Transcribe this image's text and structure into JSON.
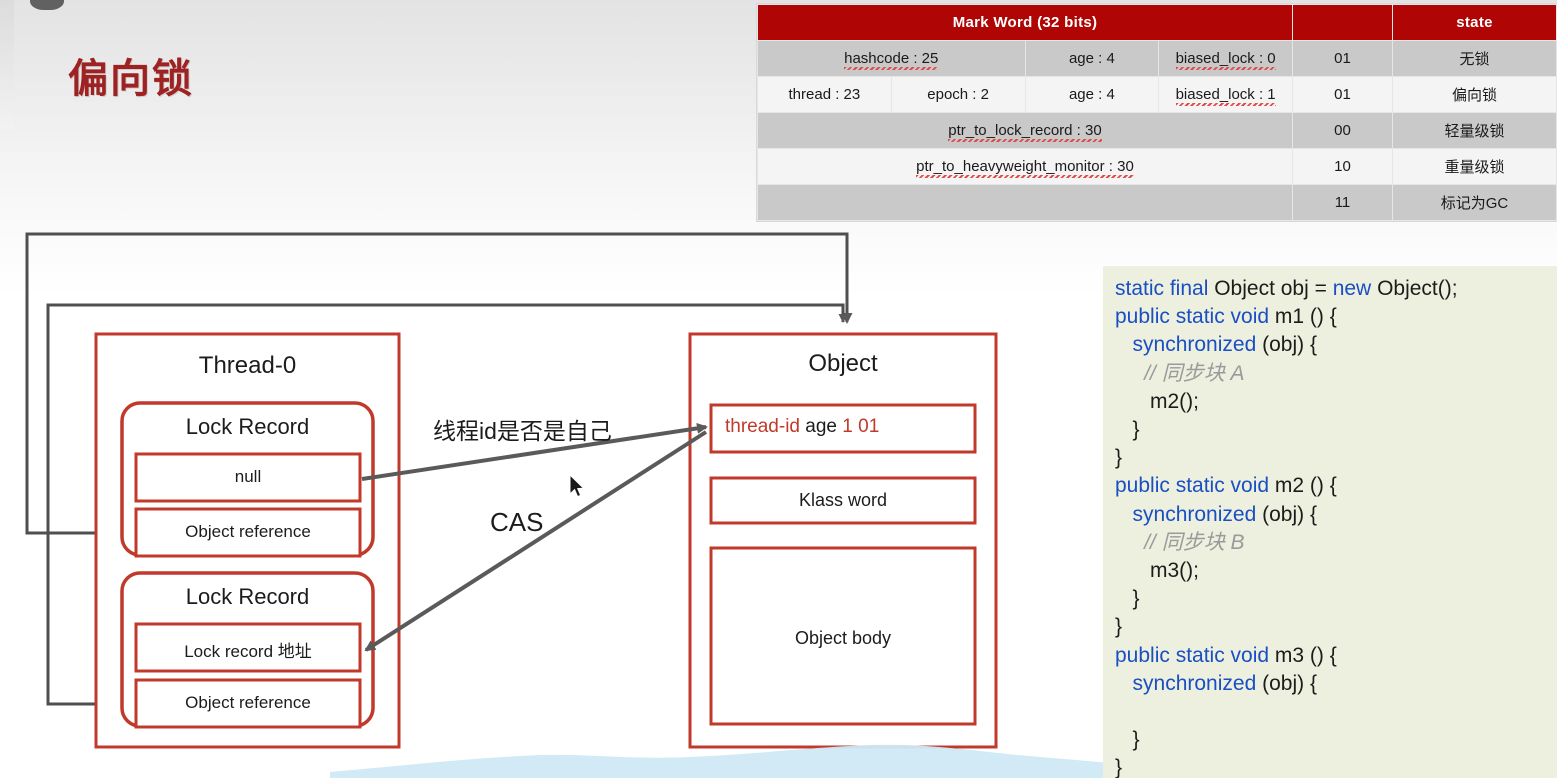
{
  "slide": {
    "title": "偏向锁"
  },
  "mark_word_table": {
    "headers": [
      "Mark Word (32 bits)",
      "state"
    ],
    "rows": [
      {
        "cells": [
          "hashcode : 25",
          "age : 4",
          "biased_lock : 0"
        ],
        "bits": "01",
        "state": "无锁",
        "shade": "dark"
      },
      {
        "cells": [
          "thread : 23",
          "epoch : 2",
          "age : 4",
          "biased_lock : 1"
        ],
        "bits": "01",
        "state": "偏向锁",
        "shade": "light"
      },
      {
        "cells": [
          "ptr_to_lock_record : 30"
        ],
        "bits": "00",
        "state": "轻量级锁",
        "shade": "dark"
      },
      {
        "cells": [
          "ptr_to_heavyweight_monitor : 30"
        ],
        "bits": "10",
        "state": "重量级锁",
        "shade": "light"
      },
      {
        "cells": [
          ""
        ],
        "bits": "11",
        "state": "标记为GC",
        "shade": "dark"
      }
    ]
  },
  "diagram": {
    "thread_box": {
      "title": "Thread-0",
      "lock_records": [
        {
          "title": "Lock Record",
          "slot_value": "null",
          "slot_ref": "Object reference"
        },
        {
          "title": "Lock Record",
          "slot_value": "Lock record 地址",
          "slot_ref": "Object reference"
        }
      ]
    },
    "object_box": {
      "title": "Object",
      "mark_word": {
        "thread_id": "thread-id",
        "age": "age",
        "biased_bit": "1",
        "lock_bits": "01"
      },
      "klass_word": "Klass word",
      "object_body": "Object body"
    },
    "annotations": {
      "check_thread_id": "线程id是否是自己",
      "cas": "CAS"
    }
  },
  "code_panel": {
    "lines": [
      [
        {
          "t": "static final ",
          "c": "kw"
        },
        {
          "t": "Object obj = ",
          "c": ""
        },
        {
          "t": "new ",
          "c": "kw"
        },
        {
          "t": "Object();",
          "c": ""
        }
      ],
      [
        {
          "t": "public static void ",
          "c": "kw"
        },
        {
          "t": "m1 () {",
          "c": ""
        }
      ],
      [
        {
          "t": "   ",
          "c": ""
        },
        {
          "t": "synchronized ",
          "c": "kw"
        },
        {
          "t": "(obj) {",
          "c": ""
        }
      ],
      [
        {
          "t": "     ",
          "c": ""
        },
        {
          "t": "// 同步块 A",
          "c": "cmt"
        }
      ],
      [
        {
          "t": "      m2();",
          "c": ""
        }
      ],
      [
        {
          "t": "   }",
          "c": ""
        }
      ],
      [
        {
          "t": "}",
          "c": ""
        }
      ],
      [
        {
          "t": "public static void ",
          "c": "kw"
        },
        {
          "t": "m2 () {",
          "c": ""
        }
      ],
      [
        {
          "t": "   ",
          "c": ""
        },
        {
          "t": "synchronized ",
          "c": "kw"
        },
        {
          "t": "(obj) {",
          "c": ""
        }
      ],
      [
        {
          "t": "     ",
          "c": ""
        },
        {
          "t": "// 同步块 B",
          "c": "cmt"
        }
      ],
      [
        {
          "t": "      m3();",
          "c": ""
        }
      ],
      [
        {
          "t": "   }",
          "c": ""
        }
      ],
      [
        {
          "t": "}",
          "c": ""
        }
      ],
      [
        {
          "t": "public static void ",
          "c": "kw"
        },
        {
          "t": "m3 () {",
          "c": ""
        }
      ],
      [
        {
          "t": "   ",
          "c": ""
        },
        {
          "t": "synchronized ",
          "c": "kw"
        },
        {
          "t": "(obj) {",
          "c": ""
        }
      ],
      [
        {
          "t": "",
          "c": ""
        }
      ],
      [
        {
          "t": "   }",
          "c": ""
        }
      ],
      [
        {
          "t": "}",
          "c": ""
        }
      ]
    ]
  },
  "colors": {
    "title_red": "#9e2222",
    "table_header_red": "#b00505",
    "diagram_red": "#c0392b",
    "code_keyword_blue": "#1a4fc4",
    "code_bg": "#edf0de",
    "connector_gray": "#5a5a5a"
  }
}
